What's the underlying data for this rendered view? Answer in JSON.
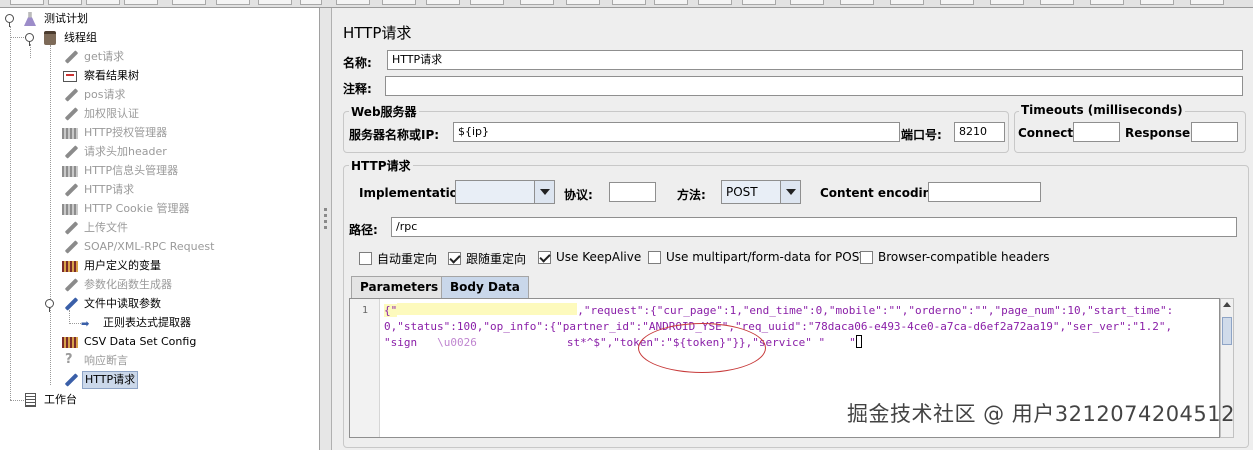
{
  "tree": {
    "items": [
      {
        "label": "测试计划",
        "icon": "test-plan-icon",
        "disabled": false
      },
      {
        "label": "线程组",
        "icon": "thread-group-icon",
        "disabled": false
      },
      {
        "label": "get请求",
        "icon": "sampler-pen-icon",
        "disabled": true
      },
      {
        "label": "察看结果树",
        "icon": "results-tree-icon",
        "disabled": false
      },
      {
        "label": "pos请求",
        "icon": "sampler-pen-icon",
        "disabled": true
      },
      {
        "label": "加权限认证",
        "icon": "sampler-pen-icon",
        "disabled": true
      },
      {
        "label": "HTTP授权管理器",
        "icon": "config-grid-icon",
        "disabled": true
      },
      {
        "label": "请求头加header",
        "icon": "sampler-pen-icon",
        "disabled": true
      },
      {
        "label": "HTTP信息头管理器",
        "icon": "config-grid-icon",
        "disabled": true
      },
      {
        "label": "HTTP请求",
        "icon": "sampler-pen-icon",
        "disabled": true
      },
      {
        "label": "HTTP Cookie 管理器",
        "icon": "config-grid-icon",
        "disabled": true
      },
      {
        "label": "上传文件",
        "icon": "sampler-pen-icon",
        "disabled": true
      },
      {
        "label": "SOAP/XML-RPC Request",
        "icon": "sampler-pen-icon",
        "disabled": true
      },
      {
        "label": "用户定义的变量",
        "icon": "variables-grid-icon",
        "disabled": false
      },
      {
        "label": "参数化函数生成器",
        "icon": "sampler-pen-icon",
        "disabled": true
      },
      {
        "label": "文件中读取参数",
        "icon": "sampler-pen-icon",
        "disabled": false
      },
      {
        "label": "正则表达式提取器",
        "icon": "extractor-arrow-icon",
        "disabled": false
      },
      {
        "label": "CSV Data Set Config",
        "icon": "variables-grid-icon",
        "disabled": false
      },
      {
        "label": "响应断言",
        "icon": "assertion-question-icon",
        "disabled": true
      },
      {
        "label": "HTTP请求",
        "icon": "sampler-pen-icon",
        "disabled": false,
        "selected": true
      },
      {
        "label": "工作台",
        "icon": "workbench-icon",
        "disabled": false
      }
    ]
  },
  "panel": {
    "title": "HTTP请求",
    "name_label": "名称:",
    "name_value": "HTTP请求",
    "comment_label": "注释:",
    "comment_value": "",
    "web_server": {
      "legend": "Web服务器",
      "server_label": "服务器名称或IP:",
      "server_value": "${ip}",
      "port_label": "端口号:",
      "port_value": "8210"
    },
    "timeouts": {
      "legend": "Timeouts (milliseconds)",
      "connect_label": "Connect:",
      "connect_value": "",
      "response_label": "Response:",
      "response_value": ""
    },
    "http_request": {
      "legend": "HTTP请求",
      "implementation_label": "Implementation:",
      "implementation_value": "",
      "protocol_label": "协议:",
      "protocol_value": "",
      "method_label": "方法:",
      "method_value": "POST",
      "encoding_label": "Content encoding:",
      "encoding_value": "",
      "path_label": "路径:",
      "path_value": "/rpc"
    },
    "options": [
      {
        "label": "自动重定向",
        "checked": false
      },
      {
        "label": "跟随重定向",
        "checked": true
      },
      {
        "label": "Use KeepAlive",
        "checked": true
      },
      {
        "label": "Use multipart/form-data for POST",
        "checked": false
      },
      {
        "label": "Browser-compatible headers",
        "checked": false
      }
    ],
    "tabs": [
      "Parameters",
      "Body Data"
    ],
    "active_tab": "Body Data",
    "body": {
      "line_number": "1",
      "line1_prefix": "{\"",
      "line1_rest": ",\"request\":{\"cur_page\":1,\"end_time\":0,\"mobile\":\"\",\"orderno\":\"\",\"page_num\":10,\"start_time\":",
      "line2": "0,\"status\":100,\"op_info\":{\"partner_id\":\"ANDROID_YSE\",\"req_uuid\":\"78daca06-e493-4ce0-a7ca-d6ef2a72aa19\",\"ser_ver\":\"1.2\",",
      "line3_a": "\"sign",
      "line3_b": "\\u0026",
      "line3_c": "st*^$\",\"token\":\"${token}\"}},\"service\" \"",
      "line3_d": "\""
    }
  },
  "watermark": "掘金技术社区 @ 用户3212074204512",
  "colors": {
    "selection": "#cbd8ea",
    "disabled_text": "#9a9a9a",
    "json_string": "#8a1fa8",
    "highlight": "#fdfabd",
    "annotation_ellipse": "#c73a3a"
  }
}
